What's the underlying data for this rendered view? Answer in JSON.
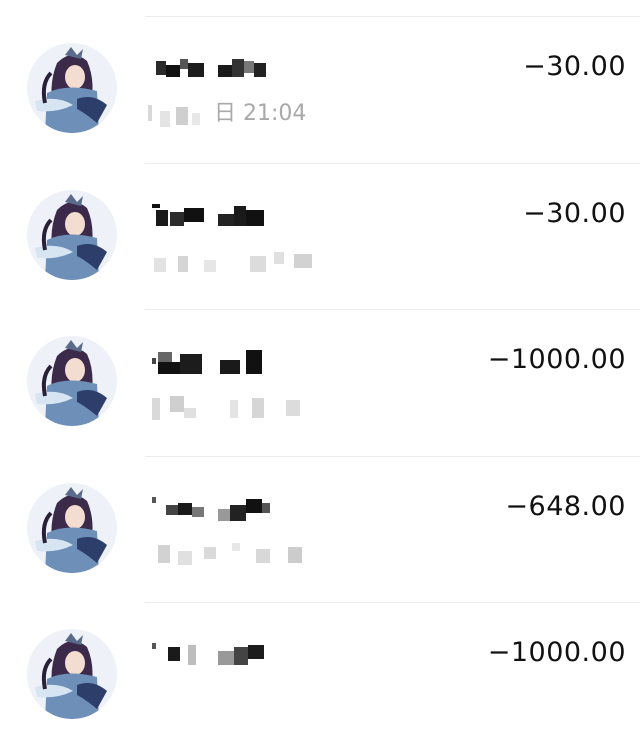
{
  "transactions": [
    {
      "amount": "−30.00",
      "time": "日 21:04"
    },
    {
      "amount": "−30.00",
      "time": ""
    },
    {
      "amount": "−1000.00",
      "time": ""
    },
    {
      "amount": "−648.00",
      "time": ""
    },
    {
      "amount": "−1000.00",
      "time": ""
    }
  ],
  "colors": {
    "amount_text": "#111111",
    "time_text": "#a9a9a9",
    "divider": "#ececec",
    "blur_dark": "#1b1b1b",
    "blur_light": "#d9d9d9"
  }
}
